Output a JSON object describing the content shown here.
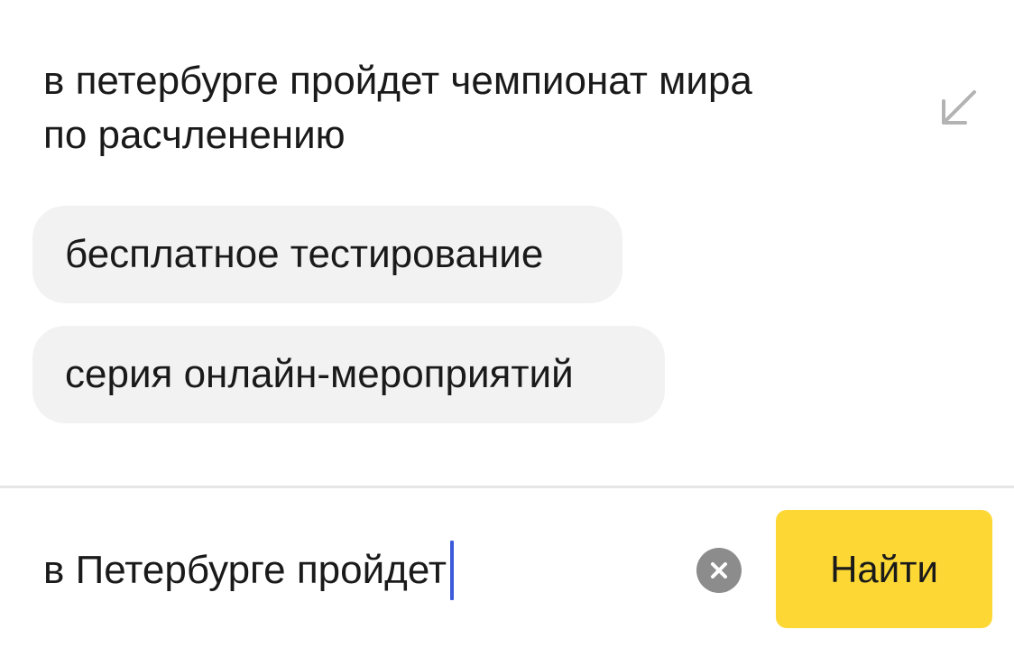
{
  "suggestion": {
    "lines": [
      "в петербурге пройдет чемпионат мира",
      "по расчленению"
    ],
    "insert_icon": "arrow-down-left-icon"
  },
  "chips": [
    {
      "label": "бесплатное тестирование"
    },
    {
      "label": "серия онлайн-мероприятий"
    }
  ],
  "search": {
    "value": "в Петербурге пройдет",
    "clear_icon": "close-circle-icon",
    "submit_label": "Найти"
  },
  "colors": {
    "accent": "#fdd835",
    "caret": "#3b5bdb",
    "chip_bg": "#f2f2f2",
    "clear_icon_bg": "#8c8c8c"
  }
}
